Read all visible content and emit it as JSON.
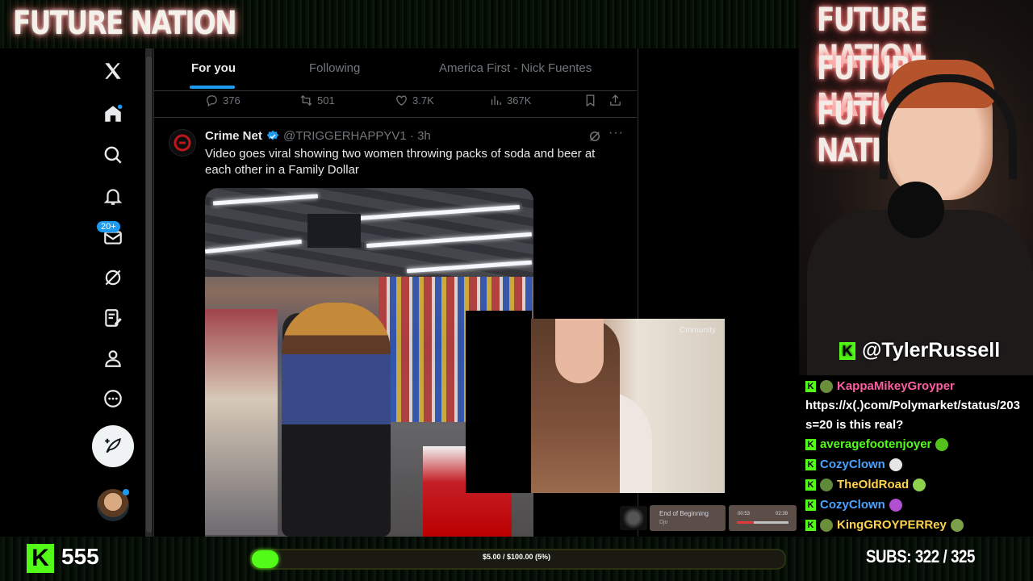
{
  "stream": {
    "brand_title": "FUTURE NATION",
    "cam_titles": [
      "FUTURE NATION",
      "FUTURE NATION",
      "FUTURE NATION"
    ],
    "streamer_handle": "@TylerRussell",
    "followers": "555",
    "goal_text": "$5.00 / $100.00 (5%)",
    "goal_progress": 0.05,
    "subs_text": "SUBS:  322 / 325",
    "kick_letter": "K",
    "accent_color": "#53fc18"
  },
  "twitter": {
    "tabs": [
      "For you",
      "Following",
      "America First - Nick Fuentes"
    ],
    "notification_badge": "20+",
    "prev_tweet_stats": {
      "replies": "376",
      "reposts": "501",
      "likes": "3.7K",
      "views": "367K"
    },
    "tweet": {
      "author_name": "Crime Net",
      "author_handle": "@TRIGGERHAPPYV1 · 3h",
      "text": "Video goes viral showing two women throwing packs of soda and beer at each other in a Family Dollar",
      "more": "···"
    },
    "accent_color": "#1d9bf0"
  },
  "overlay": {
    "watermark": "Cmmunity"
  },
  "music": {
    "title": "End of Beginning",
    "artist": "Djo",
    "elapsed": "00:53",
    "duration": "02:39",
    "progress": 0.33
  },
  "chat": [
    {
      "user": "KappaMikeyGroyper",
      "color": "#ff5fa2"
    },
    {
      "text": "https://x(.)com/Polymarket/status/203"
    },
    {
      "text": "s=20 is this real?"
    },
    {
      "user": "averagefootenjoyer",
      "color": "#53fc18"
    },
    {
      "user": "CozyClown",
      "color": "#4aa3ff"
    },
    {
      "user": "TheOldRoad",
      "color": "#ffd34a"
    },
    {
      "user": "CozyClown",
      "color": "#4aa3ff"
    },
    {
      "user": "KingGROYPERRey",
      "color": "#ffd34a"
    }
  ]
}
